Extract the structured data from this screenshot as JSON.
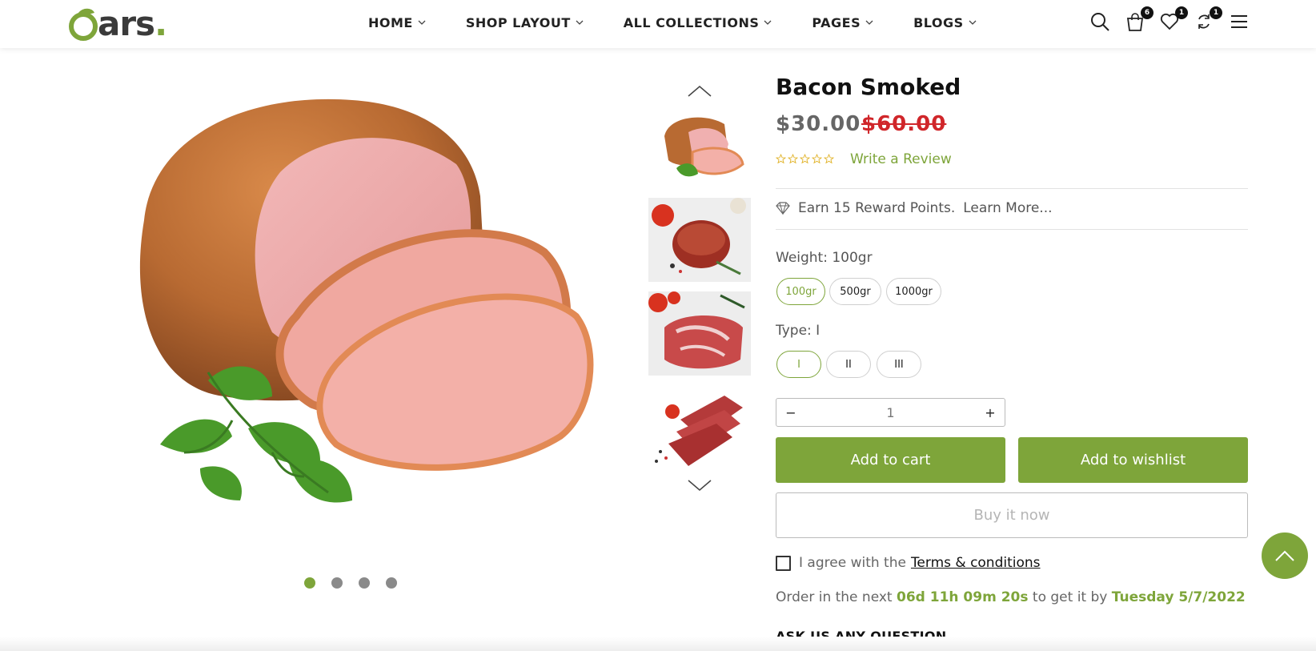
{
  "header": {
    "logo_text": "ars",
    "logo_dot": ".",
    "nav": [
      {
        "label": "HOME"
      },
      {
        "label": "SHOP LAYOUT"
      },
      {
        "label": "ALL COLLECTIONS"
      },
      {
        "label": "PAGES"
      },
      {
        "label": "BLOGS"
      }
    ],
    "icons": {
      "cart_count": "6",
      "wishlist_count": "1",
      "compare_count": "1"
    }
  },
  "product": {
    "title": "Bacon Smoked",
    "price": "$30.00",
    "old_price": "$60.00",
    "rating": 0,
    "write_review": "Write a Review",
    "reward_text": "Earn 15 Reward Points.",
    "learn_more": "Learn More...",
    "weight_label": "Weight: 100gr",
    "weights": [
      "100gr",
      "500gr",
      "1000gr"
    ],
    "type_label": "Type: I",
    "types": [
      "I",
      "II",
      "III"
    ],
    "quantity": "1",
    "qty_minus": "−",
    "qty_plus": "+",
    "add_to_cart": "Add to cart",
    "add_to_wishlist": "Add to wishlist",
    "buy_now": "Buy it now",
    "agree_text": "I agree with the",
    "terms": "Terms & conditions",
    "order_prefix": "Order in the next",
    "countdown": "06d 11h 09m 20s",
    "order_mid": "to get it by",
    "delivery_date": "Tuesday 5/7/2022",
    "ask_question": "ASK US ANY QUESTION"
  },
  "gallery": {
    "active_slide": 1,
    "slide_count": 4
  },
  "colors": {
    "accent": "#7ea53a",
    "sale": "#d0262a"
  }
}
